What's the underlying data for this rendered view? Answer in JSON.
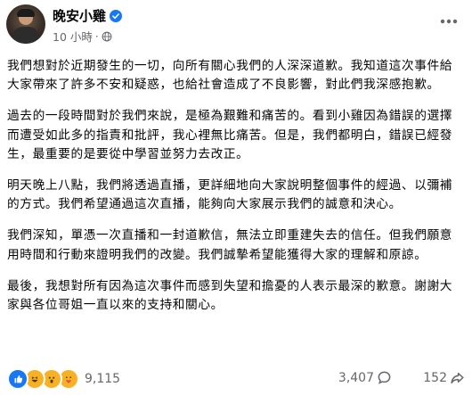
{
  "post": {
    "page_name": "晚安小雞",
    "time": "10 小時",
    "separator": "·",
    "paragraphs": [
      "我們想對於近期發生的一切，向所有關心我們的人深深道歉。我知道這次事件給大家帶來了許多不安和疑惑，也給社會造成了不良影響，對此們我深感抱歉。",
      "過去的一段時間對於我們來說，是極為艱難和痛苦的。看到小雞因為錯誤的選擇而遭受如此多的指責和批評，我心裡無比痛苦。但是，我們都明白，錯誤已經發生，最重要的是要從中學習並努力去改正。",
      "明天晚上八點，我們將透過直播，更詳細地向大家說明整個事件的經過、以彌補的方式。我們希望通過這次直播，能夠向大家展示我們的誠意和決心。",
      "我們深知，單憑一次直播和一封道歉信，無法立即重建失去的信任。但我們願意用時間和行動來證明我們的改變。我們誠摯希望能獲得大家的理解和原諒。",
      "最後，我想對所有因為這次事件而感到失望和擔憂的人表示最深的歉意。謝謝大家與各位哥姐一直以來的支持和關心。"
    ]
  },
  "engagement": {
    "reaction_count": "9,115",
    "comment_count": "3,407",
    "share_count": "152"
  },
  "icons": {
    "verified": "verified-badge-icon",
    "audience": "globe-icon",
    "more": "more-options-icon",
    "reactions": [
      "like-reaction-icon",
      "haha-reaction-icon",
      "wow-reaction-icon",
      "care-reaction-icon"
    ],
    "comment": "comment-icon",
    "share": "share-icon"
  },
  "colors": {
    "brand_blue": "#1877f2",
    "secondary_text": "#65676b",
    "primary_text": "#050505",
    "reaction_yellow": "#f7b125"
  }
}
